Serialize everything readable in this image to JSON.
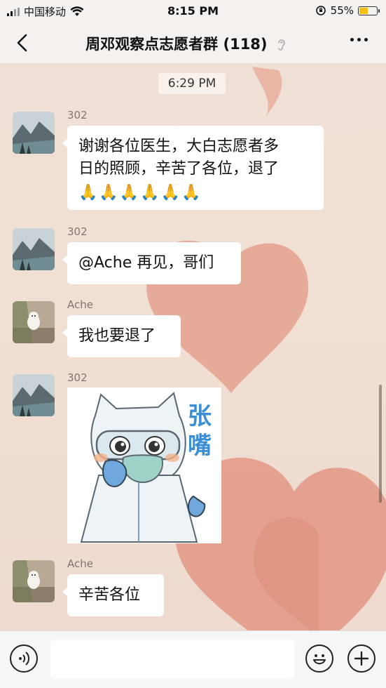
{
  "status_bar": {
    "carrier": "中国移动",
    "time": "8:15 PM",
    "battery_percent": "55%",
    "battery_level": 0.55,
    "battery_color": "#f6c10e"
  },
  "nav": {
    "title": "周邓观察点志愿者群 (118)",
    "back_icon": "chevron-left-icon",
    "more_icon": "ellipsis-icon",
    "ear_icon": "ear-icon"
  },
  "chat": {
    "timestamp": "6:29 PM",
    "messages": [
      {
        "sender": "302",
        "text_line1": "谢谢各位医生，大白志愿者多",
        "text_line2": "日的照顾，辛苦了各位，退了",
        "emojis": [
          "🙏",
          "🙏",
          "🙏",
          "🙏",
          "🙏",
          "🙏"
        ]
      },
      {
        "sender": "302",
        "text": "@Ache 再见，哥们"
      },
      {
        "sender": "Ache",
        "text": "我也要退了"
      },
      {
        "sender": "302",
        "sticker_text": "张嘴",
        "sticker": "hazmat-suit-cat-sticker"
      },
      {
        "sender": "Ache",
        "text": "辛苦各位"
      }
    ]
  },
  "input_bar": {
    "voice_icon": "voice-icon",
    "emoji_icon": "smile-icon",
    "add_icon": "plus-icon",
    "placeholder": ""
  }
}
